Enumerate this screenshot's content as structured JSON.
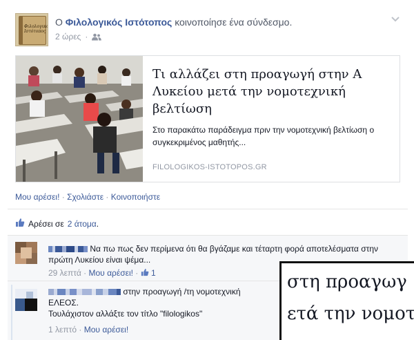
{
  "post": {
    "prefix": "Ο",
    "page_name": "Φιλολογικός Ιστότοπος",
    "action": "κοινοποίησε ένα σύνδεσμο.",
    "time": "2 ώρες",
    "avatar_text": "Φιλολογικός Ιστότοπος"
  },
  "link": {
    "title": "Τι αλλάζει στη προαγωγή στην Α Λυκείου μετά την νομοτεχνική βελτίωση",
    "description": "Στο παρακάτω παράδειγμα πριν την νομοτεχνική βελτίωση ο συγκεκριμένος μαθητής...",
    "domain": "FILOLOGIKOS-ISTOTOPOS.GR"
  },
  "actions": {
    "like": "Μου αρέσει!",
    "comment": "Σχολιάστε",
    "share": "Κοινοποιήστε",
    "sep": "·"
  },
  "likes": {
    "prefix": "Αρέσει σε",
    "count": "2 άτομα",
    "suffix": "."
  },
  "comments": [
    {
      "text": "Να πω πως δεν περίμενα ότι θα βγάζαμε και τέταρτη φορά αποτελέσματα στην πρώτη Λυκείου είναι ψέμα...",
      "time": "29 λεπτά",
      "like": "Μου αρέσει!",
      "like_count": "1"
    },
    {
      "text_line1": "στην προαγωγή /τη νομοτεχνική",
      "text_line2": "ΕΛΕΟΣ.",
      "text_line3": "Τουλάχιστον αλλάξτε τον τίτλο \"filologikos\"",
      "time": "1 λεπτό",
      "like": "Μου αρέσει!"
    }
  ],
  "zoom": {
    "line1": "στη προαγωγ",
    "line2": "ετά την νομοτ"
  },
  "colors": {
    "link": "#3b5998",
    "meta": "#9197a3",
    "text": "#141823"
  }
}
